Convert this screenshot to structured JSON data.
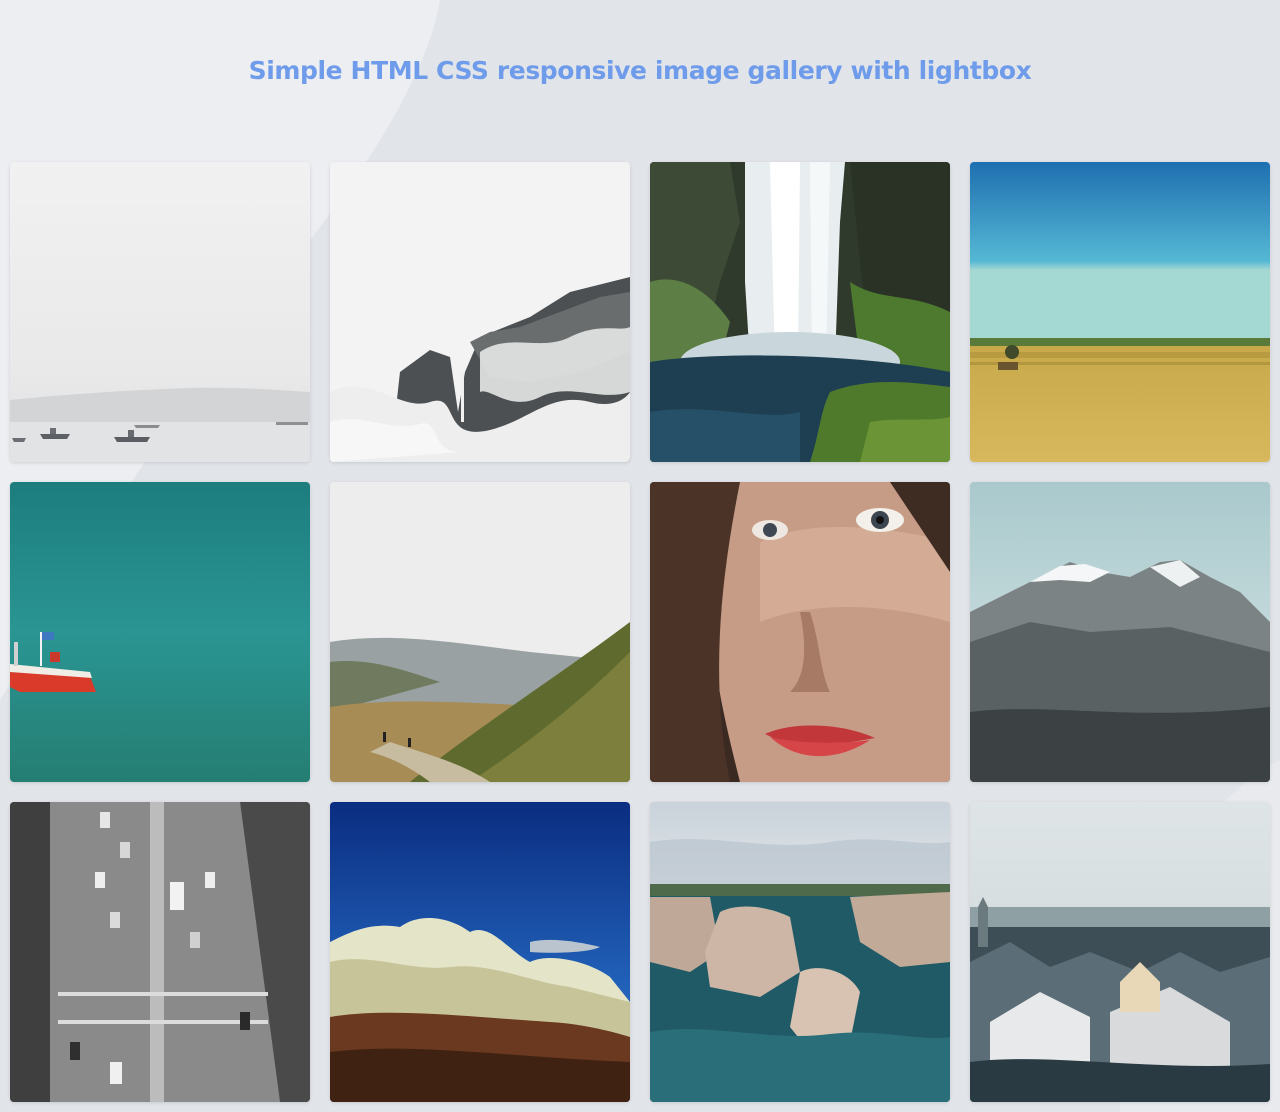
{
  "page": {
    "title": "Simple HTML CSS responsive image gallery with lightbox"
  },
  "colors": {
    "background": "#e1e4e9",
    "title": "#6e9bea"
  },
  "gallery": {
    "images": [
      {
        "subject": "misty-sea-with-boats"
      },
      {
        "subject": "cloudy-mountain-cliffs"
      },
      {
        "subject": "waterfall"
      },
      {
        "subject": "wheat-field-blue-sky"
      },
      {
        "subject": "turquoise-sea-red-boat"
      },
      {
        "subject": "mountain-trail-hikers"
      },
      {
        "subject": "woman-face-portrait"
      },
      {
        "subject": "snowy-mountain"
      },
      {
        "subject": "city-street-traffic-bw"
      },
      {
        "subject": "clouds-blue-sky"
      },
      {
        "subject": "coastal-rock-formations"
      },
      {
        "subject": "snowy-city-rooftops"
      }
    ]
  }
}
